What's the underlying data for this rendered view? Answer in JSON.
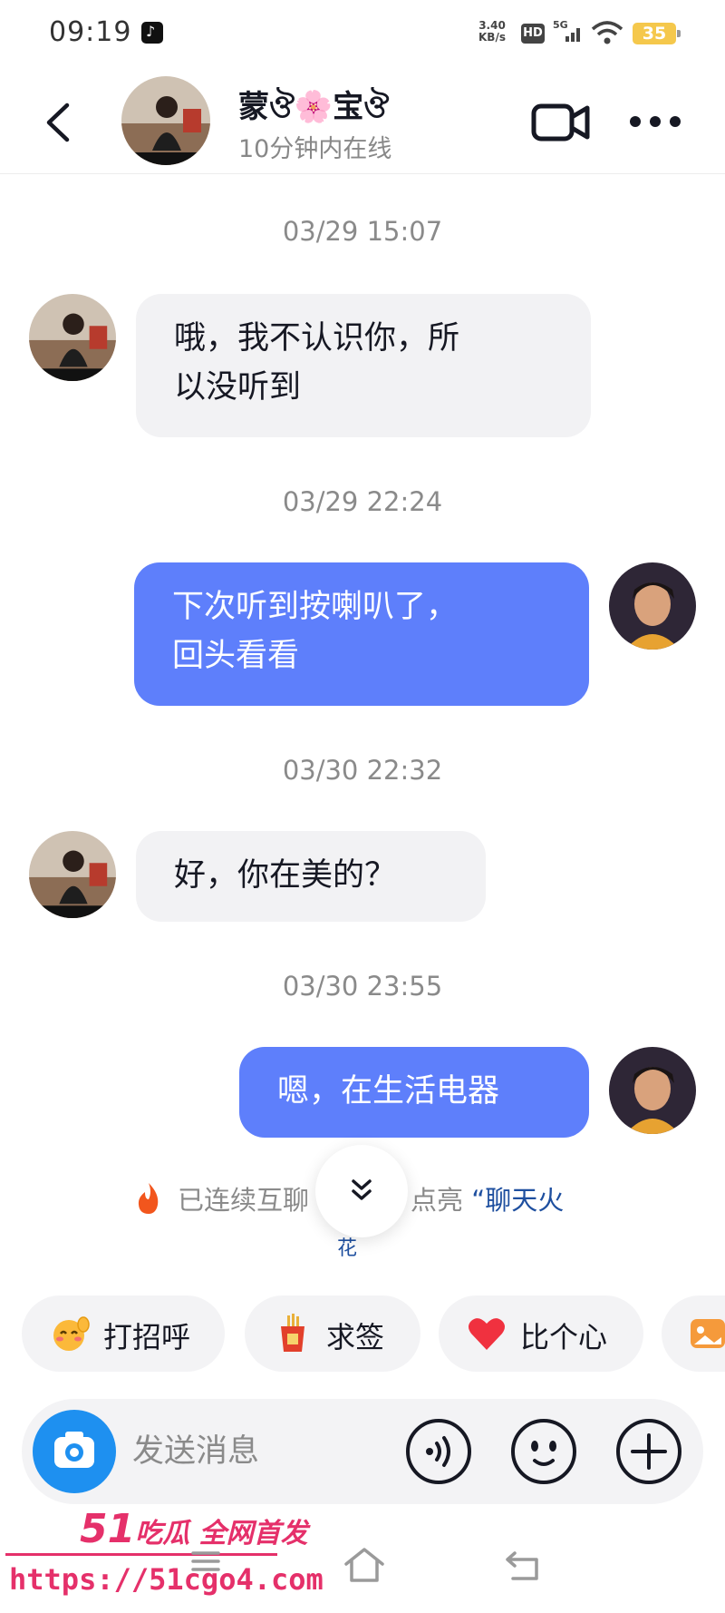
{
  "status_bar": {
    "time": "09:19",
    "net_speed_value": "3.40",
    "net_speed_unit": "KB/s",
    "hd_label": "HD",
    "signal_label": "5G",
    "battery": "35"
  },
  "header": {
    "contact_name": "蒙ঔ🌸宝ঔ",
    "contact_status": "10分钟内在线"
  },
  "messages": [
    {
      "timestamp": "03/29 15:07",
      "direction": "incoming",
      "text_line1": "哦，我不认识你，所",
      "text_line2": "以没听到"
    },
    {
      "timestamp": "03/29 22:24",
      "direction": "outgoing",
      "text_line1": "下次听到按喇叭了，",
      "text_line2": "回头看看"
    },
    {
      "timestamp": "03/30 22:32",
      "direction": "incoming",
      "text_line1": "好，你在美的？"
    },
    {
      "timestamp": "03/30 23:55",
      "direction": "outgoing",
      "text_line1": "嗯，在生活电器"
    }
  ],
  "chat_fire_tip": {
    "text": "已连续互聊",
    "middle": "点亮",
    "highlight": "“聊天火",
    "tail": "花"
  },
  "quick_replies": [
    {
      "label": "打招呼",
      "icon": "wave-emoji-icon"
    },
    {
      "label": "求签",
      "icon": "fortune-stick-icon"
    },
    {
      "label": "比个心",
      "icon": "heart-icon"
    }
  ],
  "input": {
    "placeholder": "发送消息"
  },
  "watermark": {
    "num": "51",
    "text": "吃瓜 全网首发",
    "url": "https://51cgo4.com"
  },
  "colors": {
    "outgoing_bubble": "#5e7ffb",
    "incoming_bubble": "#f2f2f4",
    "camera_button": "#1e90f0",
    "watermark": "#e5306a"
  }
}
